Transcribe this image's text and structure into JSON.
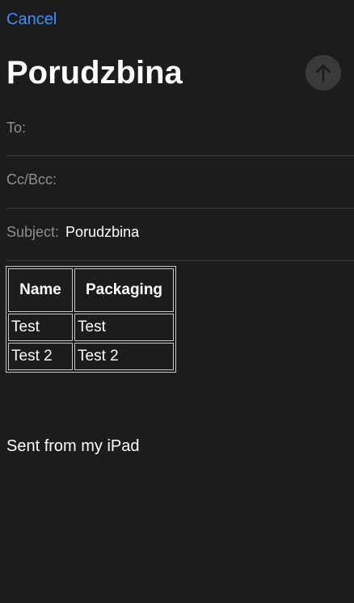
{
  "header": {
    "cancel_label": "Cancel",
    "title": "Porudzbina",
    "send_icon": "arrow-up-icon",
    "send_button_color": "#3a3a3c"
  },
  "fields": {
    "to_label": "To:",
    "to_value": "",
    "cc_label": "Cc/Bcc:",
    "cc_value": "",
    "subject_label": "Subject:",
    "subject_value": "Porudzbina"
  },
  "body": {
    "table": {
      "headers": [
        "Name",
        "Packaging"
      ],
      "rows": [
        [
          "Test",
          "Test"
        ],
        [
          "Test 2",
          "Test 2"
        ]
      ]
    },
    "signature": "Sent from my iPad"
  },
  "colors": {
    "background": "#1c1c1e",
    "accent": "#3d8ef7",
    "label": "#8e8e93",
    "divider": "#3a3a3c"
  }
}
